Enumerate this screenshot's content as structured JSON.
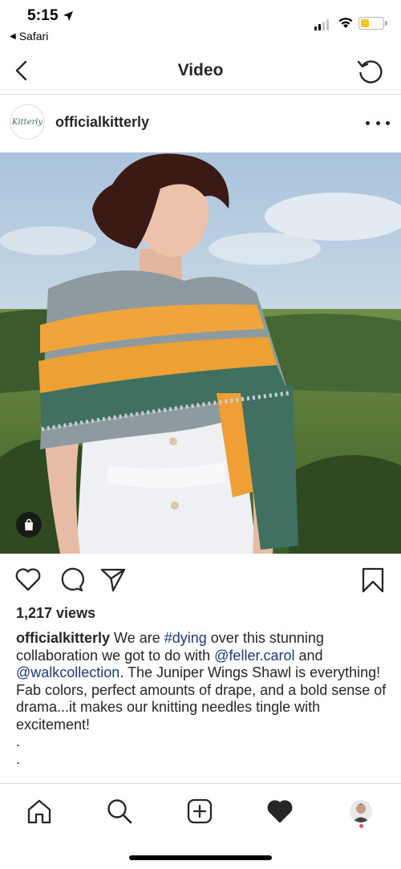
{
  "status_bar": {
    "time": "5:15",
    "back_app": "Safari",
    "signal_bars": 2,
    "battery_level": 0.4,
    "battery_color": "#f5c42c"
  },
  "nav": {
    "title": "Video",
    "back_icon": "chevron-left-icon",
    "refresh_icon": "refresh-icon"
  },
  "post": {
    "avatar_text": "Kitterly",
    "username": "officialkitterly",
    "more_icon": "more-horizontal-icon",
    "views": "1,217 views",
    "caption": {
      "user": "officialkitterly",
      "t1": " We are ",
      "hashtag": "#dying",
      "t2": " over this stunning collaboration we got to do with ",
      "mention1": "@feller.carol",
      "t3": " and ",
      "mention2": "@walkcollection",
      "t4": ". The Juniper Wings Shawl is everything! Fab colors, perfect amounts of drape, and a bold sense of drama...it makes our knitting needles tingle with excitement!"
    },
    "dot1": ".",
    "dot2": ".",
    "link_color": "#1e3a78"
  },
  "actions": [
    "heart-icon",
    "comment-icon",
    "share-icon",
    "bookmark-icon"
  ],
  "tabs": [
    "home-icon",
    "search-icon",
    "add-post-icon",
    "activity-heart-icon",
    "profile-avatar"
  ]
}
